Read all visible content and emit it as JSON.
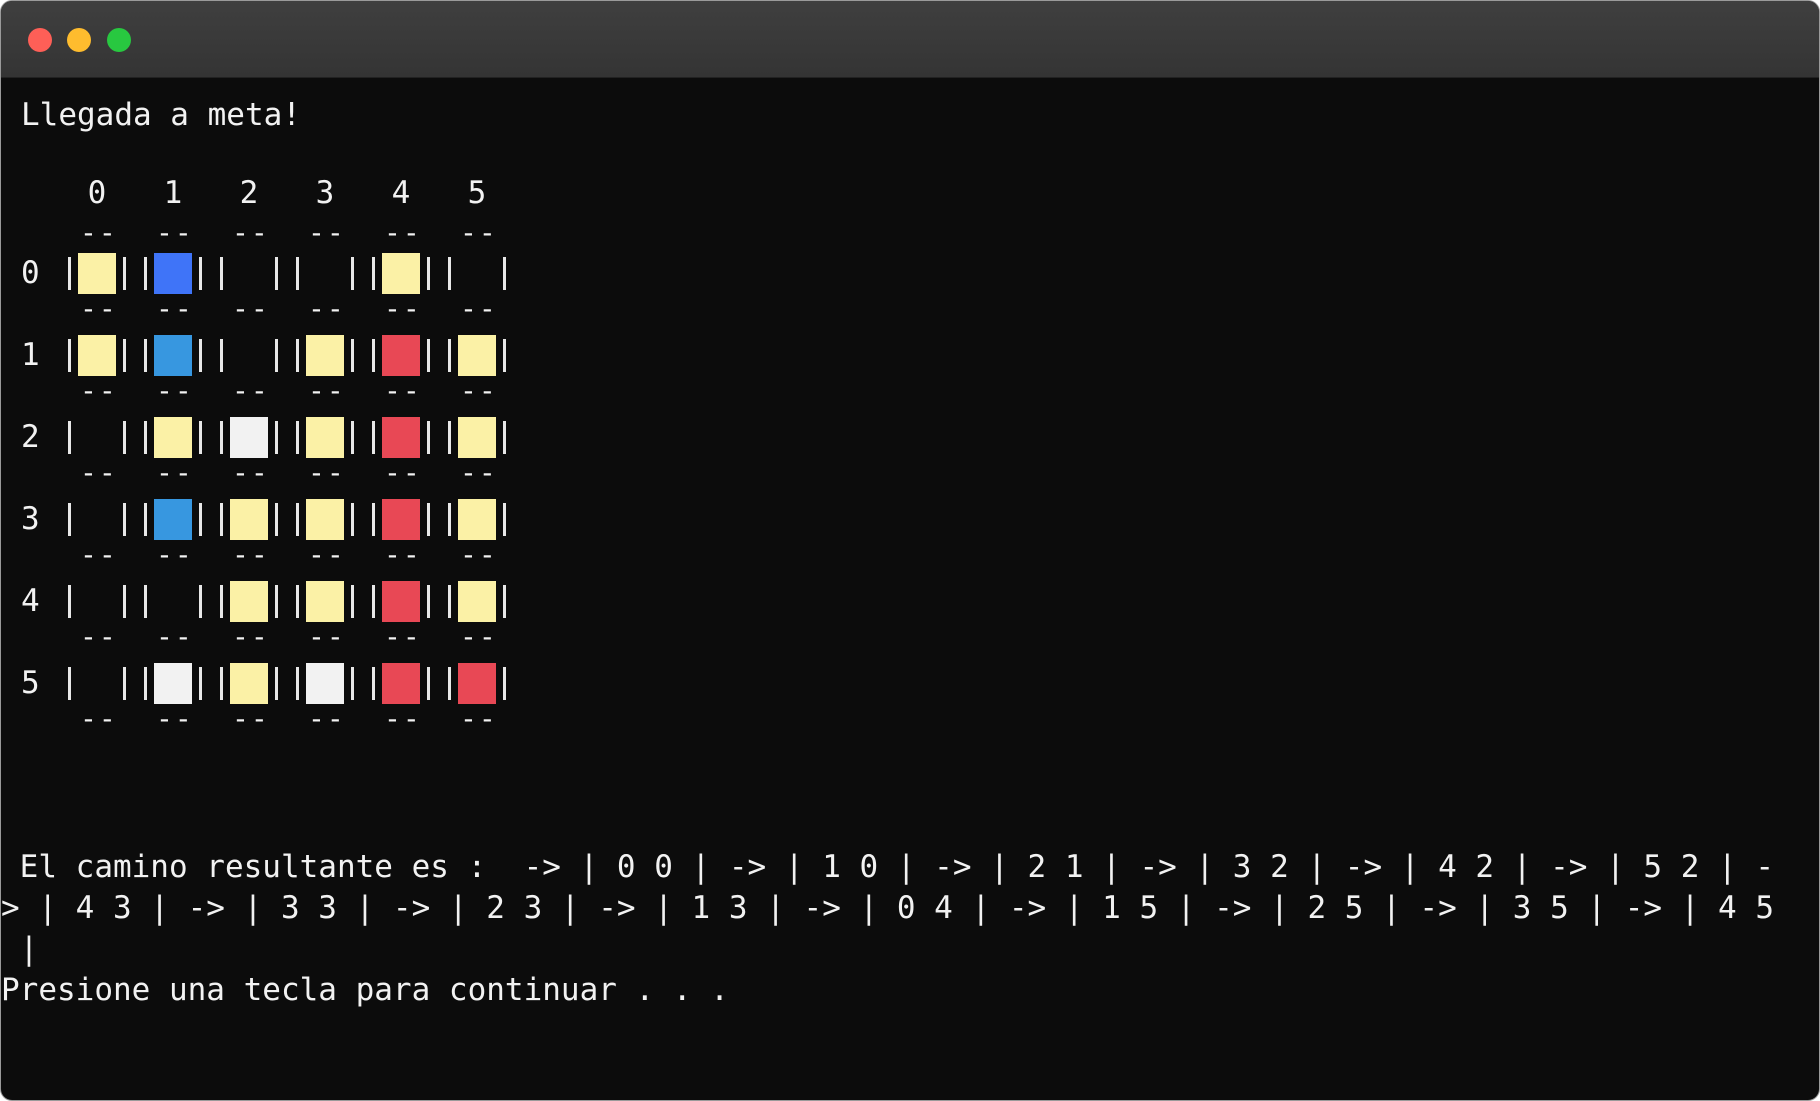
{
  "window": {
    "title": ""
  },
  "terminal": {
    "header": "Llegada a meta!",
    "column_labels": [
      "0",
      "1",
      "2",
      "3",
      "4",
      "5"
    ],
    "row_labels": [
      "0",
      "1",
      "2",
      "3",
      "4",
      "5"
    ],
    "separator": "--",
    "cell_colors": {
      "empty": "#0c0c0c",
      "yellow": "#fbf1a6",
      "blue": "#3f74f8",
      "lightblue": "#3797e0",
      "red": "#e84855",
      "white": "#f2f2f2"
    },
    "grid": [
      [
        "yellow",
        "blue",
        "empty",
        "empty",
        "yellow",
        "empty"
      ],
      [
        "yellow",
        "lightblue",
        "empty",
        "yellow",
        "red",
        "yellow"
      ],
      [
        "empty",
        "yellow",
        "white",
        "yellow",
        "red",
        "yellow"
      ],
      [
        "empty",
        "lightblue",
        "yellow",
        "yellow",
        "red",
        "yellow"
      ],
      [
        "empty",
        "empty",
        "yellow",
        "yellow",
        "red",
        "yellow"
      ],
      [
        "empty",
        "white",
        "yellow",
        "white",
        "red",
        "red"
      ]
    ],
    "path_line_1": " El camino resultante es :  -> | 0 0 | -> | 1 0 | -> | 2 1 | -> | 3 2 | -> | 4 2 | -> | 5 2 | -",
    "path_line_2": "> | 4 3 | -> | 3 3 | -> | 2 3 | -> | 1 3 | -> | 0 4 | -> | 1 5 | -> | 2 5 | -> | 3 5 | -> | 4 5",
    "path_line_3": " |",
    "prompt": "Presione una tecla para continuar . . ."
  }
}
